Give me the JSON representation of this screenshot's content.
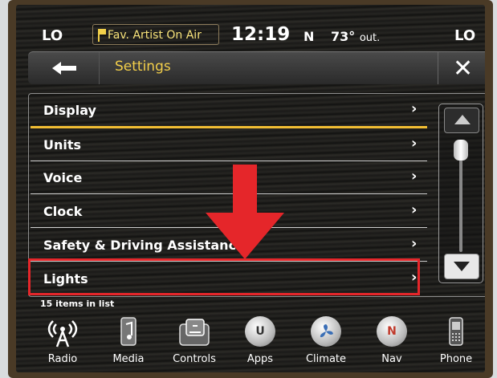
{
  "status": {
    "temp_left": "LO",
    "temp_right": "LO",
    "favorite": "Fav. Artist On Air",
    "time": "12:19",
    "compass": "N",
    "temperature": "73°",
    "temp_suffix": "out."
  },
  "header": {
    "title": "Settings",
    "back_icon": "arrow-left-icon",
    "close_icon": "close-icon",
    "close_glyph": "✕"
  },
  "list": {
    "items": [
      {
        "label": "Display",
        "chevron": "›"
      },
      {
        "label": "Units",
        "chevron": "›"
      },
      {
        "label": "Voice",
        "chevron": "›"
      },
      {
        "label": "Clock",
        "chevron": "›"
      },
      {
        "label": "Safety & Driving Assistance",
        "chevron": "›"
      },
      {
        "label": "Lights",
        "chevron": "›"
      }
    ],
    "count_text": "15 items in list"
  },
  "dock": {
    "items": [
      {
        "label": "Radio",
        "icon": "radio-tower-icon"
      },
      {
        "label": "Media",
        "icon": "media-icon"
      },
      {
        "label": "Controls",
        "icon": "controls-icon"
      },
      {
        "label": "Apps",
        "icon": "apps-icon",
        "glyph": "U"
      },
      {
        "label": "Climate",
        "icon": "climate-icon"
      },
      {
        "label": "Nav",
        "icon": "compass-icon",
        "glyph": "N"
      },
      {
        "label": "Phone",
        "icon": "phone-icon"
      }
    ]
  },
  "colors": {
    "accent": "#f3cf4a",
    "highlight": "#e5262a",
    "annotation_arrow": "#e5262a"
  }
}
